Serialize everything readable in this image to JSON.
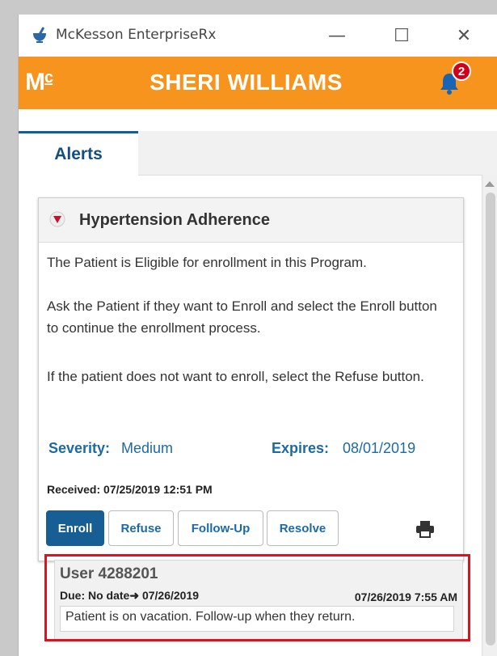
{
  "window": {
    "title": "McKesson EnterpriseRx",
    "minimize_glyph": "—",
    "maximize_glyph": "☐",
    "close_glyph": "✕"
  },
  "header": {
    "logo_main": "M",
    "logo_sub": "c",
    "user_name": "SHERI WILLIAMS",
    "notification_count": "2",
    "bell_icon": "bell-icon"
  },
  "colors": {
    "brand_orange": "#f7941d",
    "primary_blue": "#165e93",
    "link_blue": "#1d6aa2",
    "badge_red": "#d0021b",
    "highlight_red": "#e0101e"
  },
  "tabs": [
    {
      "label": "Alerts",
      "active": true
    }
  ],
  "alert": {
    "title": "Hypertension Adherence",
    "paragraphs": [
      "The Patient is Eligible for enrollment in this Program.",
      "Ask the Patient if they want to Enroll and select the Enroll button to continue the enrollment process.",
      "If the patient does not want to enroll, select the Refuse button."
    ],
    "severity_label": "Severity:",
    "severity_value": "Medium",
    "expires_label": "Expires:",
    "expires_value": "08/01/2019",
    "received": "Received: 07/25/2019 12:51 PM",
    "buttons": {
      "enroll": "Enroll",
      "refuse": "Refuse",
      "followup": "Follow-Up",
      "resolve": "Resolve"
    },
    "print_icon": "printer-icon"
  },
  "note": {
    "user": "User 4288201",
    "due": "Due: No date➜ 07/26/2019",
    "timestamp": "07/26/2019 7:55 AM",
    "text": "Patient is on vacation. Follow-up when they return."
  }
}
